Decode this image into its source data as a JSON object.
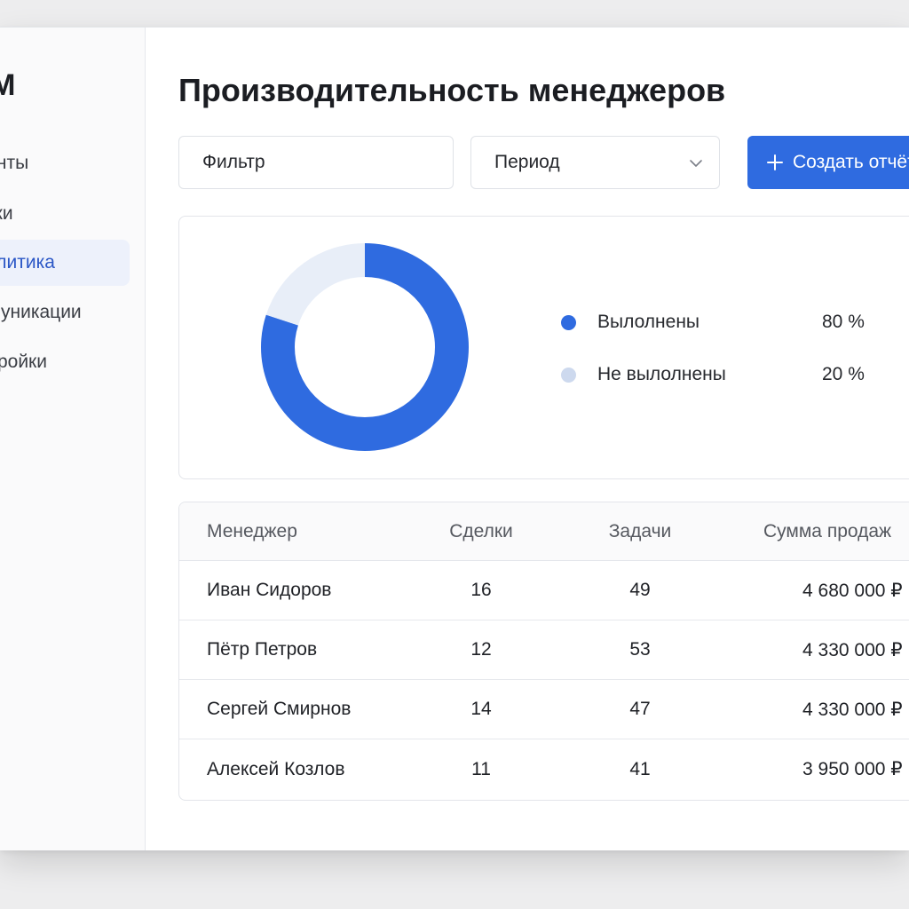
{
  "sidebar": {
    "logo": "CRM",
    "items": [
      {
        "label": "Клиенты",
        "active": false
      },
      {
        "label": "Сделки",
        "active": false
      },
      {
        "label": "Аналитика",
        "active": true
      },
      {
        "label": "Коммуникации",
        "active": false
      },
      {
        "label": "Настройки",
        "active": false
      }
    ]
  },
  "header": {
    "title": "Производительность менеджеров"
  },
  "toolbar": {
    "filter_placeholder": "Фильтр",
    "period_label": "Период",
    "create_label": "Создать отчёт"
  },
  "chart_data": {
    "type": "pie",
    "categories": [
      "Вылолнены",
      "Не вылолнены"
    ],
    "values": [
      80,
      20
    ],
    "value_labels": [
      "80 %",
      "20 %"
    ],
    "colors": [
      "#2f6be0",
      "#e8eef8"
    ],
    "legend_dot_colors": [
      "#2f6be0",
      "#cdd9ee"
    ],
    "legend": "right"
  },
  "table": {
    "headers": [
      "Менеджер",
      "Сделки",
      "Задачи",
      "Сумма продаж"
    ],
    "rows": [
      {
        "name": "Иван Сидоров",
        "deals": "16",
        "tasks": "49",
        "sum": "4 680 000 ₽"
      },
      {
        "name": "Пётр Петров",
        "deals": "12",
        "tasks": "53",
        "sum": "4 330 000 ₽"
      },
      {
        "name": "Сергей Смирнов",
        "deals": "14",
        "tasks": "47",
        "sum": "4 330 000 ₽"
      },
      {
        "name": "Алексей Козлов",
        "deals": "11",
        "tasks": "41",
        "sum": "3 950 000 ₽"
      }
    ]
  }
}
